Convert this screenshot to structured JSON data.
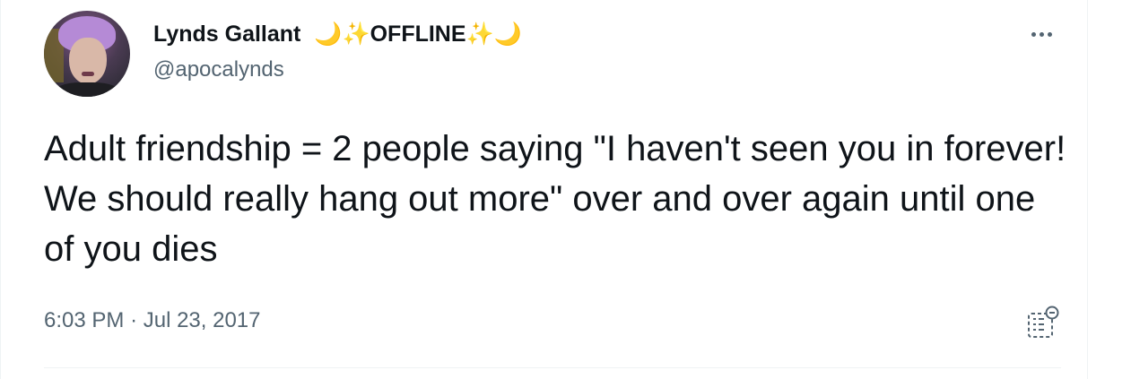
{
  "tweet": {
    "author_name": "Lynds Gallant",
    "name_suffix": "🌙✨OFFLINE✨🌙",
    "handle": "@apocalynds",
    "text": "Adult friendship = 2 people saying \"I haven't seen you in forever! We should really hang out more\" over and over again until one of you dies",
    "time": "6:03 PM",
    "separator": "·",
    "date": "Jul 23, 2017"
  },
  "icons": {
    "more": "more-horizontal-icon",
    "analytics": "analytics-icon"
  },
  "colors": {
    "text_primary": "#0f1419",
    "text_secondary": "#536471",
    "divider": "#eff3f4",
    "moon": "#f5c842",
    "sparkle": "#f5b82e"
  }
}
